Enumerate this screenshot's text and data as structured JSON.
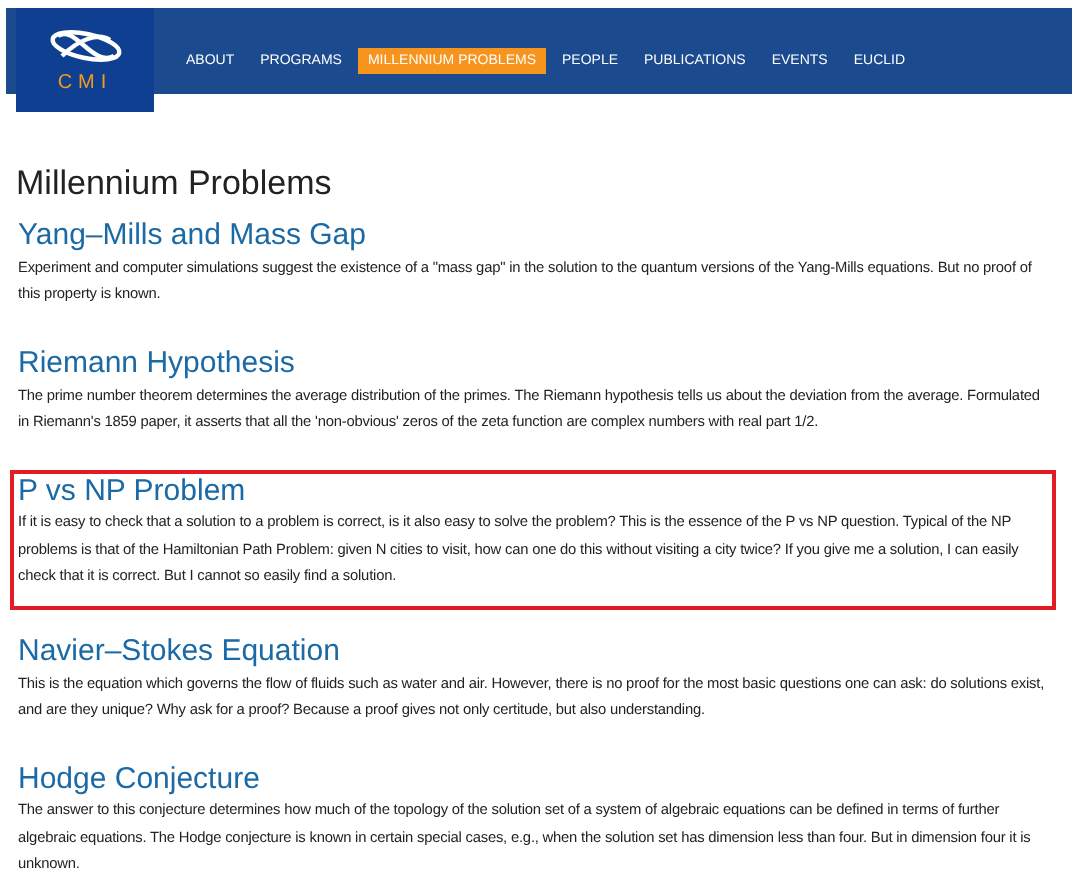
{
  "logo": {
    "text": "CMI"
  },
  "nav": [
    {
      "label": "ABOUT",
      "selected": false
    },
    {
      "label": "PROGRAMS",
      "selected": false
    },
    {
      "label": "MILLENNIUM PROBLEMS",
      "selected": true
    },
    {
      "label": "PEOPLE",
      "selected": false
    },
    {
      "label": "PUBLICATIONS",
      "selected": false
    },
    {
      "label": "EVENTS",
      "selected": false
    },
    {
      "label": "EUCLID",
      "selected": false
    }
  ],
  "page_title": "Millennium Problems",
  "problems": [
    {
      "title": "Yang–Mills and Mass Gap",
      "text": "Experiment and computer simulations suggest the existence of a \"mass gap\" in the solution to the quantum versions of the Yang-Mills equations. But no proof of this property is known.",
      "highlighted": false
    },
    {
      "title": "Riemann Hypothesis",
      "text": "The prime number theorem determines the average distribution of the primes. The Riemann hypothesis tells us about the deviation from the average. Formulated in Riemann's 1859 paper, it asserts that all the 'non-obvious' zeros of the zeta function are complex numbers with real part 1/2.",
      "highlighted": false
    },
    {
      "title": "P vs NP Problem",
      "text": "If it is easy to check that a solution to a problem is correct, is it also easy to solve the problem? This is the essence of the P vs NP question. Typical of the NP problems is that of the Hamiltonian Path Problem: given N cities to visit, how can one do this without visiting a city twice? If you give me a solution, I can easily check that it is correct. But I cannot so easily find a solution.",
      "highlighted": true
    },
    {
      "title": "Navier–Stokes Equation",
      "text": "This is the equation which governs the flow of fluids such as water and air. However, there is no proof for the most basic questions one can ask: do solutions exist, and are they unique? Why ask for a proof? Because a proof gives not only certitude, but also understanding.",
      "highlighted": false
    },
    {
      "title": "Hodge Conjecture",
      "text": "The answer to this conjecture determines how much of the topology of the solution set of a system of algebraic equations can be defined in terms of further algebraic equations. The Hodge conjecture is known in certain special cases, e.g., when the solution set has dimension less than four. But in dimension four it is unknown.",
      "highlighted": false
    }
  ]
}
